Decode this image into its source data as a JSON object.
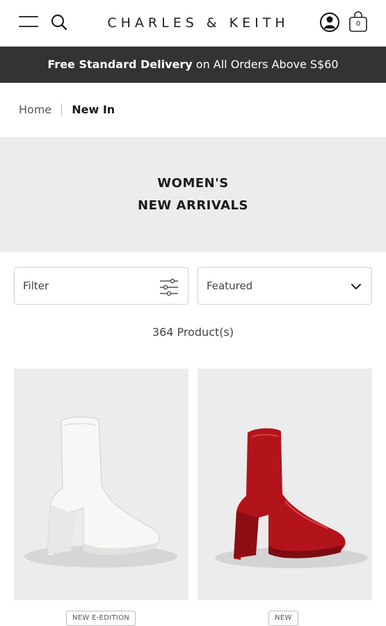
{
  "header": {
    "logo": "CHARLES & KEITH",
    "bag_count": "0"
  },
  "promo": {
    "bold": "Free Standard Delivery",
    "rest": " on All Orders Above S$60"
  },
  "breadcrumb": {
    "home": "Home",
    "current": "New In"
  },
  "hero": {
    "line1": "WOMEN'S",
    "line2": "NEW ARRIVALS"
  },
  "controls": {
    "filter_label": "Filter",
    "sort_label": "Featured"
  },
  "product_count": "364 Product(s)",
  "products": [
    {
      "badge": "NEW E-EDITION",
      "color": "#f2f2f0"
    },
    {
      "badge": "NEW",
      "color": "#b3141c"
    }
  ],
  "colors": {
    "promo_bg": "#333333",
    "hero_bg": "#ececec"
  }
}
